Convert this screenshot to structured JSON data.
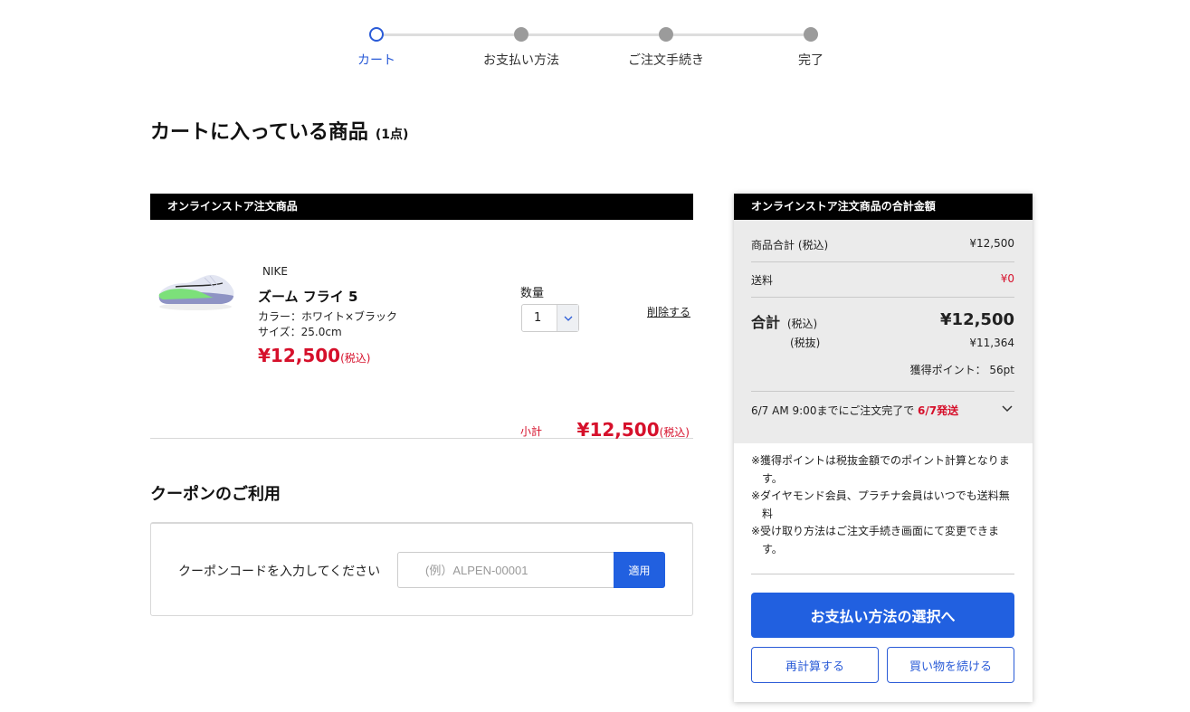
{
  "steps": [
    {
      "label": "カート",
      "current": true
    },
    {
      "label": "お支払い方法",
      "current": false
    },
    {
      "label": "ご注文手続き",
      "current": false
    },
    {
      "label": "完了",
      "current": false
    }
  ],
  "page": {
    "title": "カートに入っている商品",
    "count": "(1点)"
  },
  "cart": {
    "section_header": "オンラインストア注文商品",
    "item": {
      "brand": "NIKE",
      "name": "ズーム フライ 5",
      "color": "カラー：ホワイト×ブラック",
      "size": "サイズ：25.0cm",
      "price": "¥12,500",
      "tax_note": "(税込)",
      "qty_label": "数量",
      "qty_value": "1",
      "delete_label": "削除する"
    },
    "subtotal_label": "小計",
    "subtotal_value": "¥12,500",
    "subtotal_tax_note": "(税込)"
  },
  "coupon": {
    "title": "クーポンのご利用",
    "prompt": "クーポンコードを入力してください",
    "placeholder": "(例）ALPEN-00001",
    "apply_label": "適用"
  },
  "summary": {
    "header": "オンラインストア注文商品の合計金額",
    "items_label": "商品合計 (税込)",
    "items_value": "¥12,500",
    "shipping_label": "送料",
    "shipping_value": "¥0",
    "total_label": "合計",
    "tax_in": "(税込)",
    "tax_ex": "(税抜)",
    "total_value": "¥12,500",
    "total_ex_value": "¥11,364",
    "points": "獲得ポイント： 56pt",
    "delivery_text": "6/7 AM 9:00までにご注文完了で",
    "delivery_highlight": "6/7発送",
    "notes": [
      "※獲得ポイントは税抜金額でのポイント計算となります。",
      "※ダイヤモンド会員、プラチナ会員はいつでも送料無料",
      "※受け取り方法はご注文手続き画面にて変更できます。"
    ],
    "primary_button": "お支払い方法の選択へ",
    "recalc_button": "再計算する",
    "continue_button": "買い物を続ける"
  },
  "colors": {
    "accent": "#2160e0",
    "price_red": "#d6102b",
    "header_black": "#000000",
    "summary_gray": "#ebebeb"
  },
  "icons": {
    "qty_dropdown": "chevron-down-icon",
    "delivery_expand": "chevron-down-icon",
    "step_current": "step-circle-outline-icon",
    "step_pending": "step-dot-icon"
  }
}
